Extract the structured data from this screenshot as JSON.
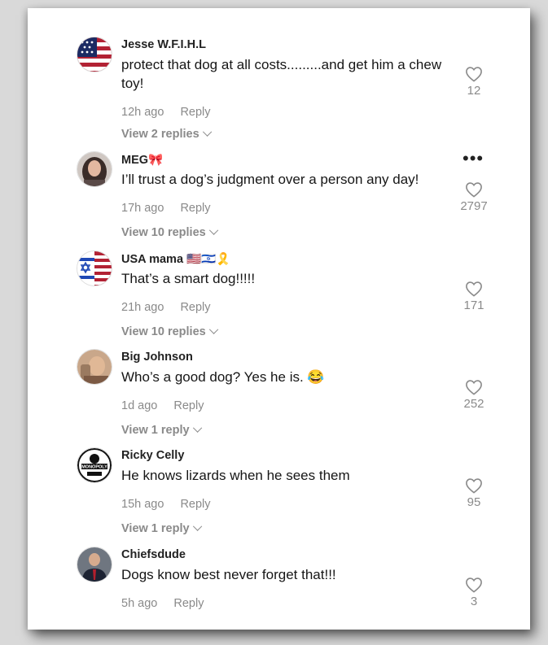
{
  "comments": [
    {
      "username": "Jesse W.F.I.H.L",
      "text": "protect that dog at all costs.........and get him a chew toy!",
      "time": "12h ago",
      "reply": "Reply",
      "view_replies": "View 2 replies",
      "likes": "12",
      "avatar": "us-flag-avatar"
    },
    {
      "username": "MEG🎀",
      "text": "I’ll trust a dog’s judgment over a person any day!",
      "time": "17h ago",
      "reply": "Reply",
      "view_replies": "View 10 replies",
      "likes": "2797",
      "more": "•••",
      "avatar": "woman-photo-avatar"
    },
    {
      "username": "USA mama 🇺🇸🇮🇱🎗️",
      "text": "That’s a smart dog!!!!!",
      "time": "21h ago",
      "reply": "Reply",
      "view_replies": "View 10 replies",
      "likes": "171",
      "avatar": "us-israel-flag-avatar"
    },
    {
      "username": "Big Johnson",
      "text": "Who’s a good dog? Yes he is. 😂",
      "time": "1d ago",
      "reply": "Reply",
      "view_replies": "View 1 reply",
      "likes": "252",
      "avatar": "person-photo-avatar"
    },
    {
      "username": "Ricky Celly",
      "text": "He knows lizards when he sees them",
      "time": "15h ago",
      "reply": "Reply",
      "view_replies": "View 1 reply",
      "likes": "95",
      "avatar": "monopoly-logo-avatar",
      "avatar_text": "MONOPOLY"
    },
    {
      "username": "Chiefsdude",
      "text": "Dogs know best never forget that!!!",
      "time": "5h ago",
      "reply": "Reply",
      "likes": "3",
      "avatar": "man-suit-photo-avatar"
    }
  ],
  "colors": {
    "text_primary": "#161616",
    "text_secondary": "#8a8a8a",
    "background": "#ffffff"
  }
}
